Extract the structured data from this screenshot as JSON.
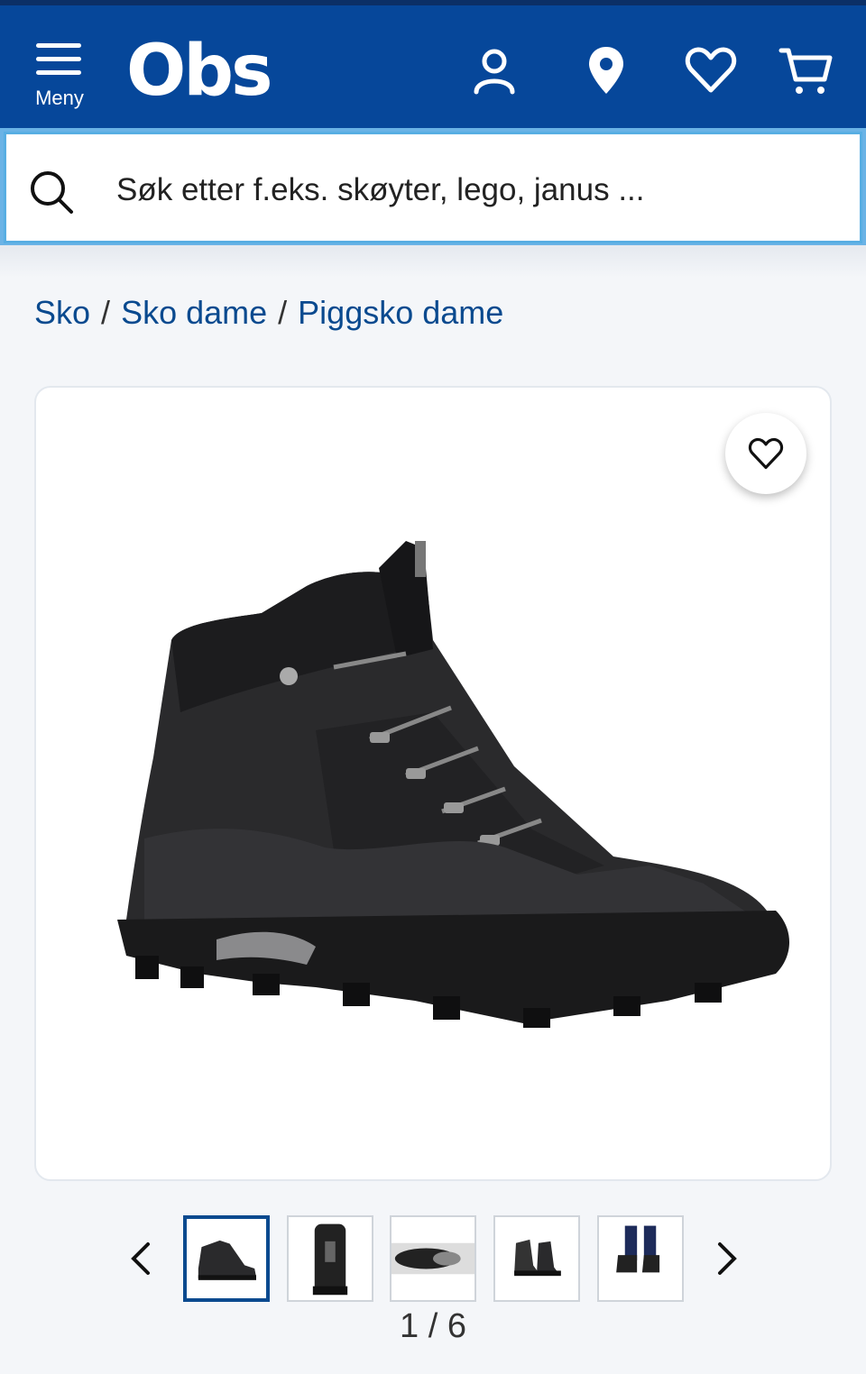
{
  "header": {
    "menu_label": "Meny",
    "logo_text": "Obs",
    "brand_color": "#06479a",
    "icons": [
      "user-icon",
      "location-pin-icon",
      "heart-icon",
      "cart-icon"
    ]
  },
  "search": {
    "placeholder": "Søk etter f.eks. skøyter, lego, janus ...",
    "icon": "search-icon"
  },
  "breadcrumb": {
    "items": [
      "Sko",
      "Sko dame",
      "Piggsko dame"
    ],
    "separator": "/"
  },
  "gallery": {
    "favorite_icon": "heart-icon",
    "counter": "1 / 6",
    "thumbnails": [
      "boot-side",
      "boot-back",
      "boot-sole",
      "boot-pair",
      "boot-worn"
    ],
    "active_index": 0
  }
}
